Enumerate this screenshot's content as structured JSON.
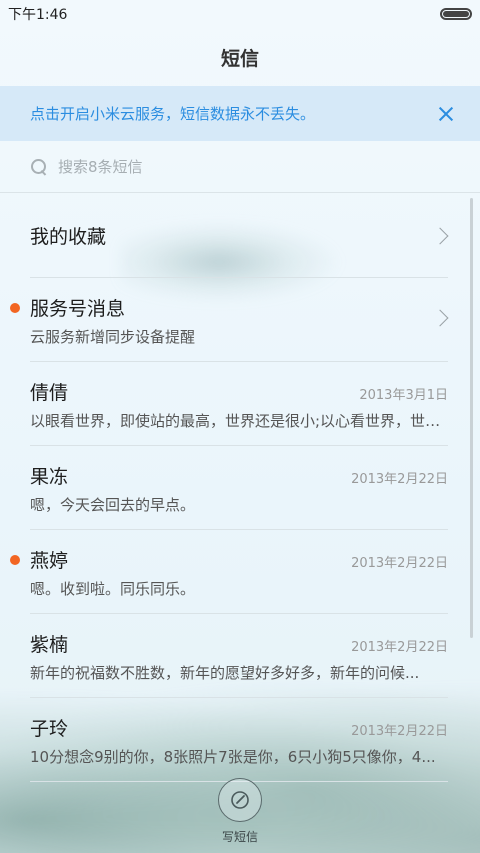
{
  "status_bar": {
    "time": "下午1:46"
  },
  "header": {
    "title": "短信"
  },
  "banner": {
    "text": "点击开启小米云服务，短信数据永不丢失。"
  },
  "search": {
    "placeholder": "搜索8条短信"
  },
  "conversations": [
    {
      "title": "我的收藏",
      "subtitle": "",
      "date": "",
      "unread": false,
      "chevron": true
    },
    {
      "title": "服务号消息",
      "subtitle": "云服务新增同步设备提醒",
      "date": "",
      "unread": true,
      "chevron": true
    },
    {
      "title": "倩倩",
      "subtitle": "以眼看世界，即使站的最高，世界还是很小;以心看世界，世界...",
      "date": "2013年3月1日",
      "unread": false,
      "chevron": false
    },
    {
      "title": "果冻",
      "subtitle": "嗯，今天会回去的早点。",
      "date": "2013年2月22日",
      "unread": false,
      "chevron": false
    },
    {
      "title": "燕婷",
      "subtitle": "嗯。收到啦。同乐同乐。",
      "date": "2013年2月22日",
      "unread": true,
      "chevron": false
    },
    {
      "title": "紫楠",
      "subtitle": "新年的祝福数不胜数，新年的愿望好多好多，新年的问候...",
      "date": "2013年2月22日",
      "unread": false,
      "chevron": false
    },
    {
      "title": "子玲",
      "subtitle": "10分想念9别的你，8张照片7张是你，6只小狗5只像你，4...",
      "date": "2013年2月22日",
      "unread": false,
      "chevron": false
    }
  ],
  "compose": {
    "label": "写短信"
  },
  "colors": {
    "accent": "#2b8de0",
    "unread_dot": "#f26522",
    "banner_bg": "#d6e9f8"
  },
  "icons": {
    "search": "search-icon",
    "close": "close-icon",
    "chevron": "chevron-right-icon",
    "compose": "compose-icon"
  }
}
